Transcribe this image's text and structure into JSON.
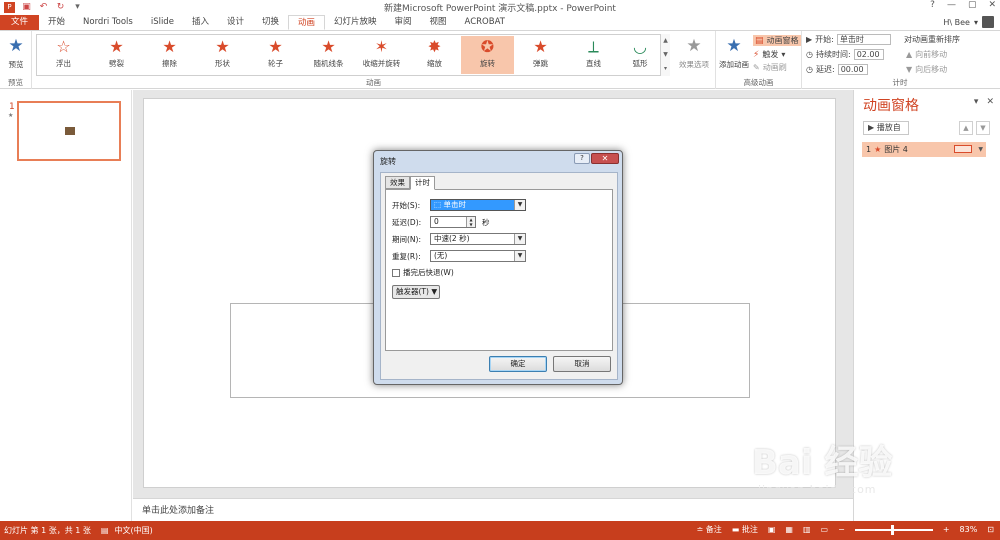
{
  "window": {
    "title": "新建Microsoft PowerPoint 演示文稿.pptx - PowerPoint",
    "help": "?",
    "minimize": "—",
    "restore": "▢",
    "close": "✕"
  },
  "qat": [
    "save-icon",
    "undo-icon",
    "redo-icon",
    "customize-icon"
  ],
  "tabs": [
    "文件",
    "开始",
    "Nordri Tools",
    "iSlide",
    "插入",
    "设计",
    "切换",
    "动画",
    "幻灯片放映",
    "审阅",
    "视图",
    "ACROBAT"
  ],
  "active_tab": "动画",
  "user": "H\\ Bee",
  "ribbon": {
    "preview": {
      "label": "预览",
      "group": "预览"
    },
    "gallery": [
      {
        "label": "浮出",
        "icon": "star-icon"
      },
      {
        "label": "劈裂",
        "icon": "star-icon"
      },
      {
        "label": "擦除",
        "icon": "star-icon"
      },
      {
        "label": "形状",
        "icon": "star-icon"
      },
      {
        "label": "轮子",
        "icon": "star-icon"
      },
      {
        "label": "随机线条",
        "icon": "star-icon"
      },
      {
        "label": "收缩并旋转",
        "icon": "star-icon"
      },
      {
        "label": "缩放",
        "icon": "star-icon"
      },
      {
        "label": "旋转",
        "icon": "star-icon",
        "selected": true
      },
      {
        "label": "弹跳",
        "icon": "star-icon"
      },
      {
        "label": "直线",
        "icon": "line-path-icon"
      },
      {
        "label": "弧形",
        "icon": "arc-path-icon"
      }
    ],
    "effect_options": "效果选项",
    "animation_group": "动画",
    "add_animation": "添加动画",
    "anim_pane": "动画窗格",
    "trigger": "触发",
    "anim_painter": "动画刷",
    "advanced_group": "高级动画",
    "start_label": "开始:",
    "start_value": "单击时",
    "duration_label": "持续时间:",
    "duration_value": "02.00",
    "delay_label": "延迟:",
    "delay_value": "00.00",
    "reorder_label": "对动画重新排序",
    "move_earlier": "向前移动",
    "move_later": "向后移动",
    "timing_group": "计时"
  },
  "slides": {
    "number": "1",
    "star": "★"
  },
  "notes_placeholder": "单击此处添加备注",
  "anim_pane": {
    "title": "动画窗格",
    "play_from": "播放自",
    "item_number": "1",
    "item_label": "图片 4"
  },
  "dialog": {
    "title": "旋转",
    "help": "?",
    "close": "✕",
    "tab_effect": "效果",
    "tab_timing": "计时",
    "start_label": "开始(S):",
    "start_value": "单击时",
    "delay_label": "延迟(D):",
    "delay_value": "0",
    "delay_unit": "秒",
    "duration_label": "期间(N):",
    "duration_value": "中速(2 秒)",
    "repeat_label": "重复(R):",
    "repeat_value": "(无)",
    "rewind_label": "播完后快退(W)",
    "rewind_checked": false,
    "trigger_label": "触发器(T)",
    "ok": "确定",
    "cancel": "取消"
  },
  "status": {
    "slide_info": "幻灯片 第 1 张，共 1 张",
    "language": "中文(中国)",
    "notes": "备注",
    "comments": "批注",
    "zoom": "83%"
  },
  "watermark": {
    "main": "Bai 经验",
    "sub": "jingyan.baidu.com"
  },
  "colors": {
    "accent": "#d04423",
    "status": "#c73e1d",
    "selected": "#f8c6ab"
  }
}
